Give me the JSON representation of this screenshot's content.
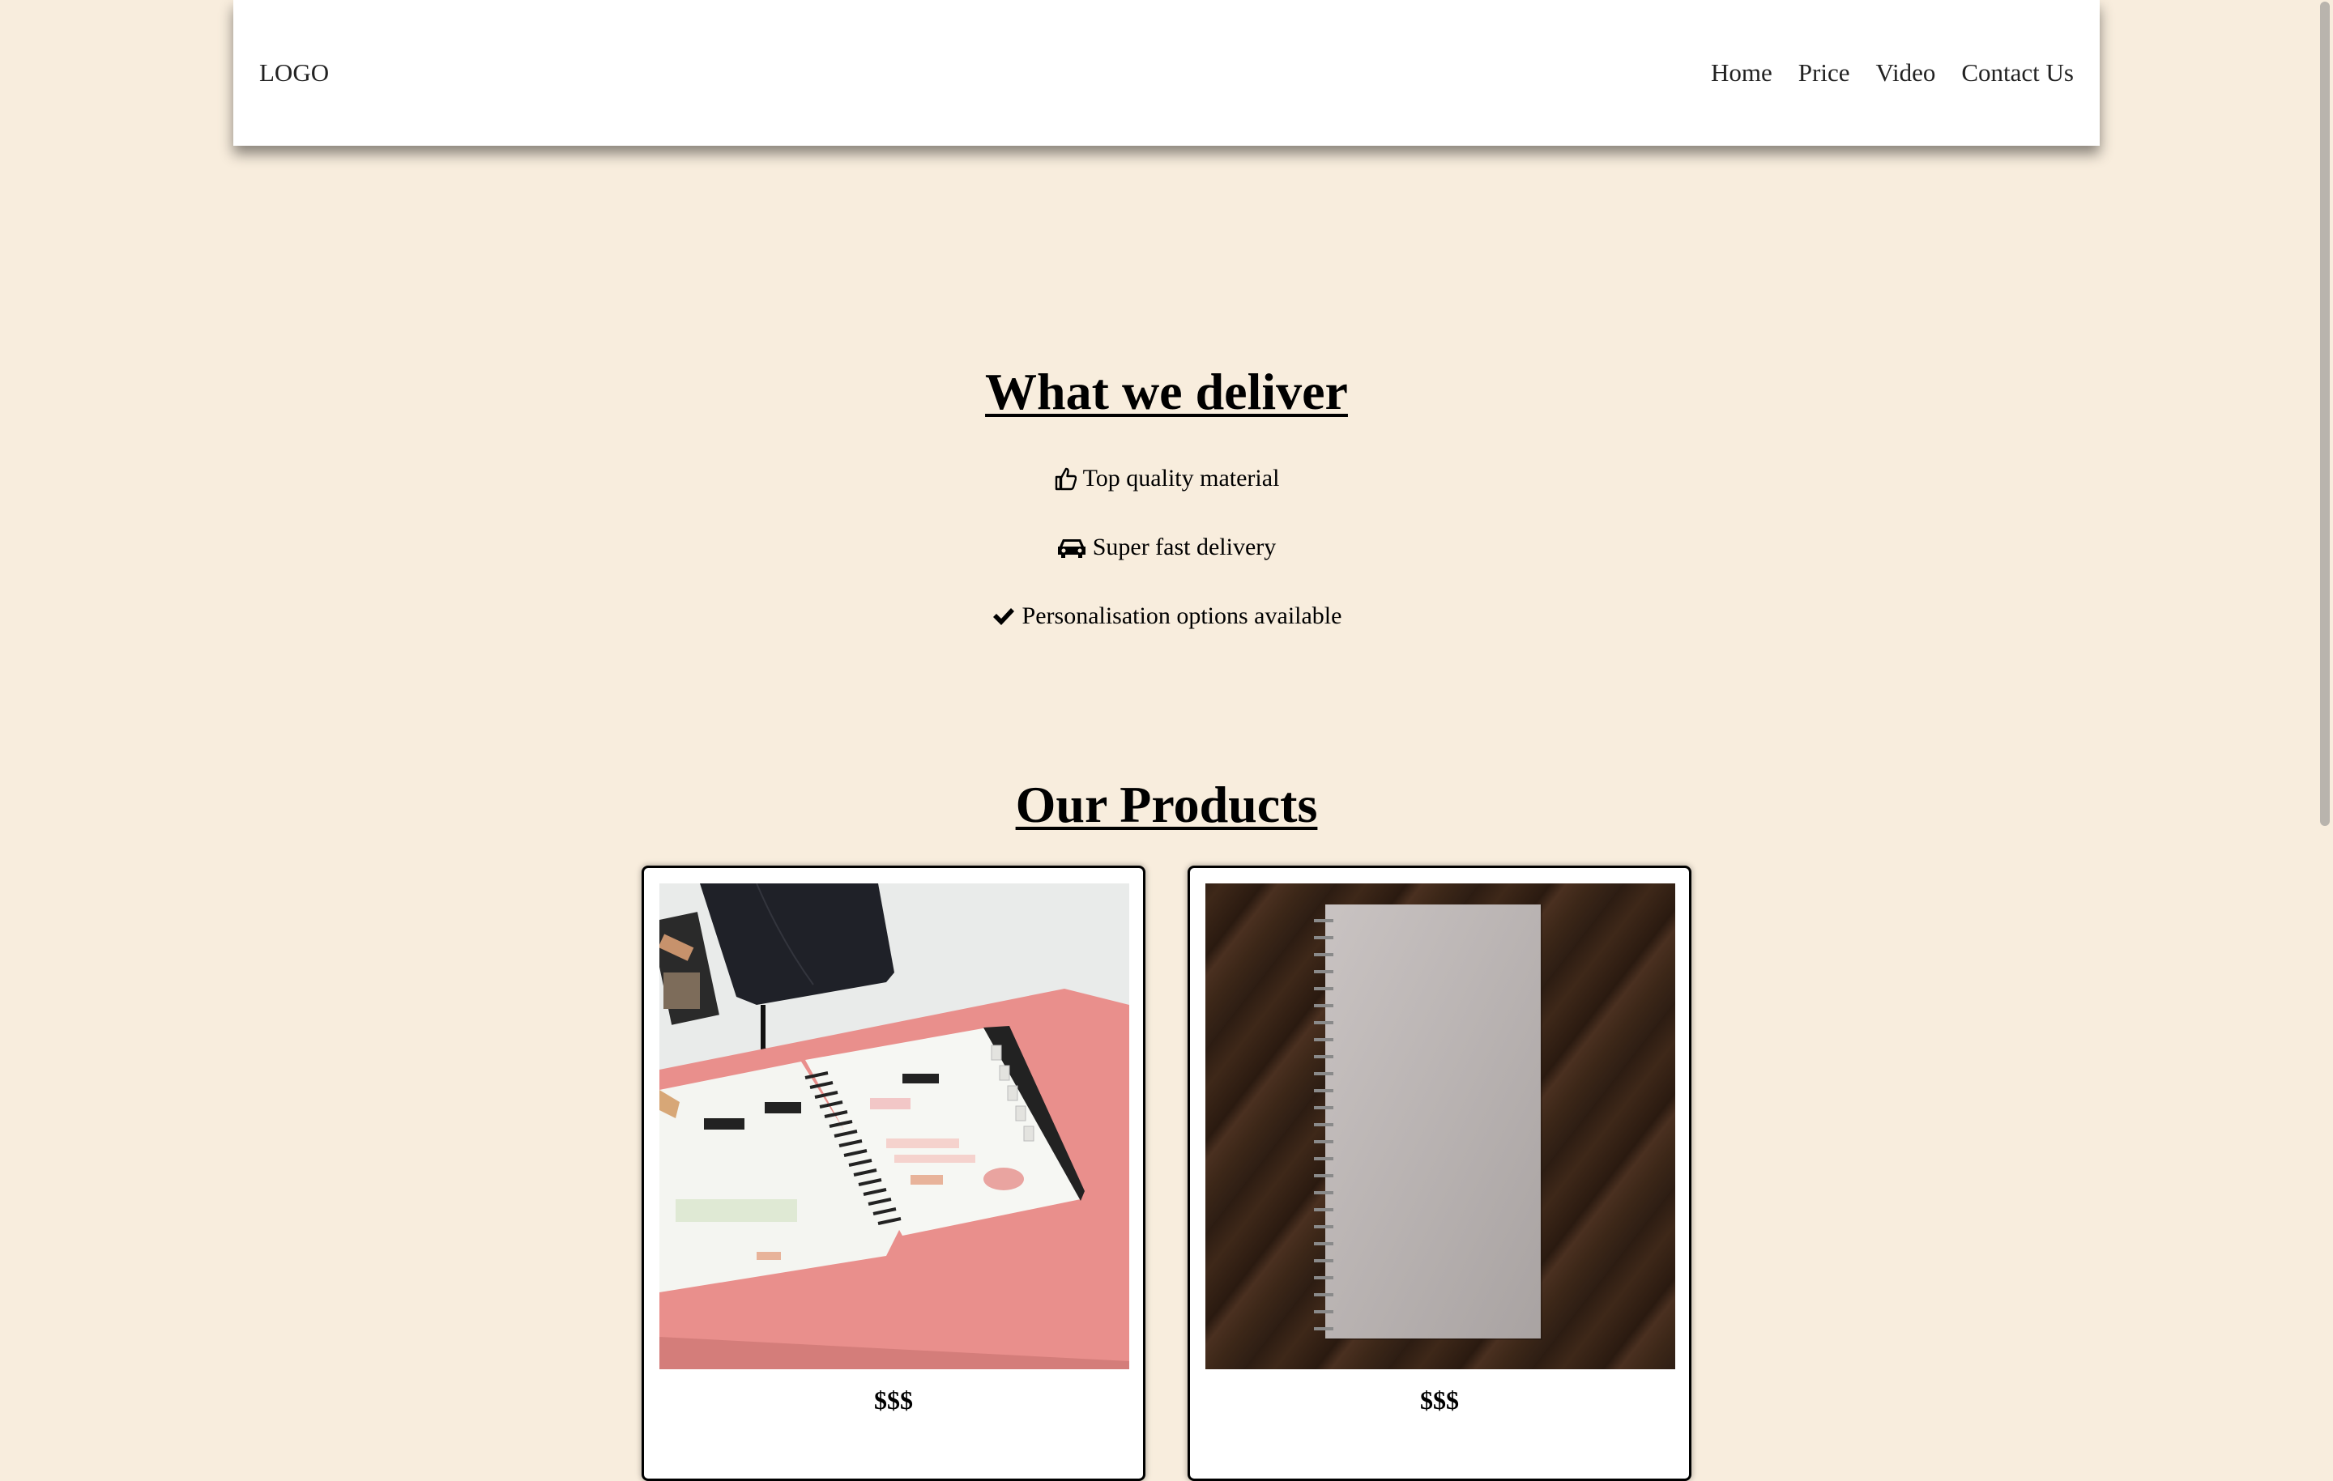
{
  "header": {
    "logo": "LOGO",
    "nav": [
      "Home",
      "Price",
      "Video",
      "Contact Us"
    ]
  },
  "deliver": {
    "title": "What we deliver",
    "features": [
      {
        "icon": "thumbs-up-icon",
        "text": "Top quality material"
      },
      {
        "icon": "car-icon",
        "text": "Super fast delivery"
      },
      {
        "icon": "check-icon",
        "text": "Personalisation options available"
      }
    ]
  },
  "products": {
    "title": "Our Products",
    "items": [
      {
        "image": "planner-photo",
        "price": "$$$"
      },
      {
        "image": "notebook-photo",
        "price": "$$$"
      }
    ]
  },
  "colors": {
    "background": "#f8eddd",
    "header_bg": "#ffffff",
    "text": "#000000"
  }
}
